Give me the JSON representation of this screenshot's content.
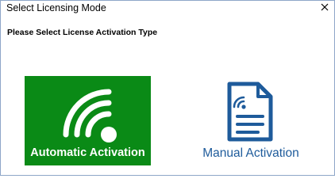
{
  "window": {
    "title": "Select Licensing Mode",
    "close_icon": "close-icon"
  },
  "main": {
    "heading": "Please Select License Activation Type"
  },
  "options": {
    "automatic": {
      "label": "Automatic Activation",
      "icon": "wifi-signal-icon",
      "tile_color": "#0a8a16",
      "label_color": "#ffffff"
    },
    "manual": {
      "label": "Manual Activation",
      "icon": "document-signal-icon",
      "label_color": "#1e5b9b"
    }
  }
}
